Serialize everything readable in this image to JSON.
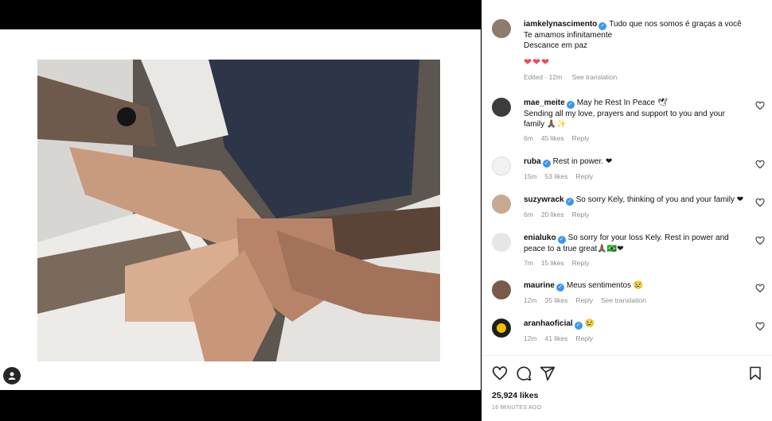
{
  "post": {
    "author": "iamkelynascimento",
    "caption_lines": [
      "Tudo que nos somos é graças a você",
      "Te amamos infinitamente",
      "Descance em paz"
    ],
    "caption_hearts": "❤❤❤",
    "edited": "Edited · 12m",
    "see_translation": "See translation"
  },
  "comments": [
    {
      "user": "mae_meite",
      "text": "May he Rest In Peace 🕊\nSending all my love, prayers and support to you and your family 🙏🏾✨",
      "time": "6m",
      "likes": "45 likes",
      "reply": "Reply"
    },
    {
      "user": "ruba",
      "text": "Rest in power. ❤",
      "time": "15m",
      "likes": "53 likes",
      "reply": "Reply"
    },
    {
      "user": "suzywrack",
      "text": "So sorry Kely, thinking of you and your family ❤",
      "time": "6m",
      "likes": "20 likes",
      "reply": "Reply"
    },
    {
      "user": "enialuko",
      "text": "So sorry for your loss Kely. Rest in power and peace to a true great🙏🏾🇧🇷❤",
      "time": "7m",
      "likes": "15 likes",
      "reply": "Reply"
    },
    {
      "user": "maurine",
      "text": "Meus sentimentos 😢",
      "time": "12m",
      "likes": "35 likes",
      "reply": "Reply",
      "see_translation": "See translation"
    },
    {
      "user": "aranhaoficial",
      "text": "😢",
      "time": "12m",
      "likes": "41 likes",
      "reply": "Reply"
    }
  ],
  "footer": {
    "likes": "25,924 likes",
    "time_ago": "16 MINUTES AGO"
  },
  "icons": [
    "heart-icon",
    "comment-icon",
    "share-icon",
    "bookmark-icon",
    "user-icon"
  ]
}
